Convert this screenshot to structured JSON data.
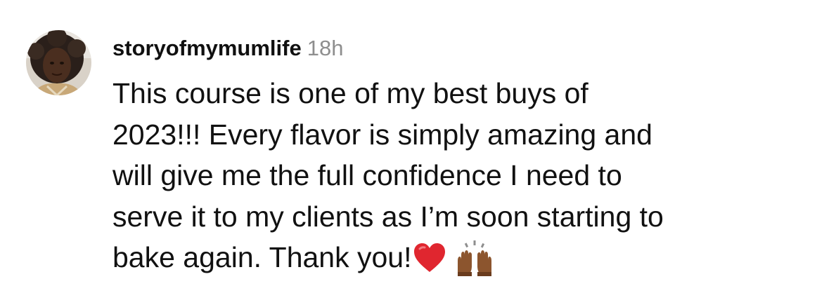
{
  "comment": {
    "username": "storyofmymumlife",
    "timestamp": "18h",
    "text": "This course is one of my best buys of\n2023!!! Every flavor is simply amazing and\nwill give me the full confidence I need to\nserve it to my clients as I’m soon starting to\nbake again. Thank you!",
    "emojis": [
      "red-heart-icon",
      "raising-hands-icon"
    ]
  },
  "colors": {
    "username": "#101010",
    "timestamp": "#8e8e8e",
    "text": "#111111",
    "heart": "#e0262f",
    "hands": "#7a4a2a"
  }
}
